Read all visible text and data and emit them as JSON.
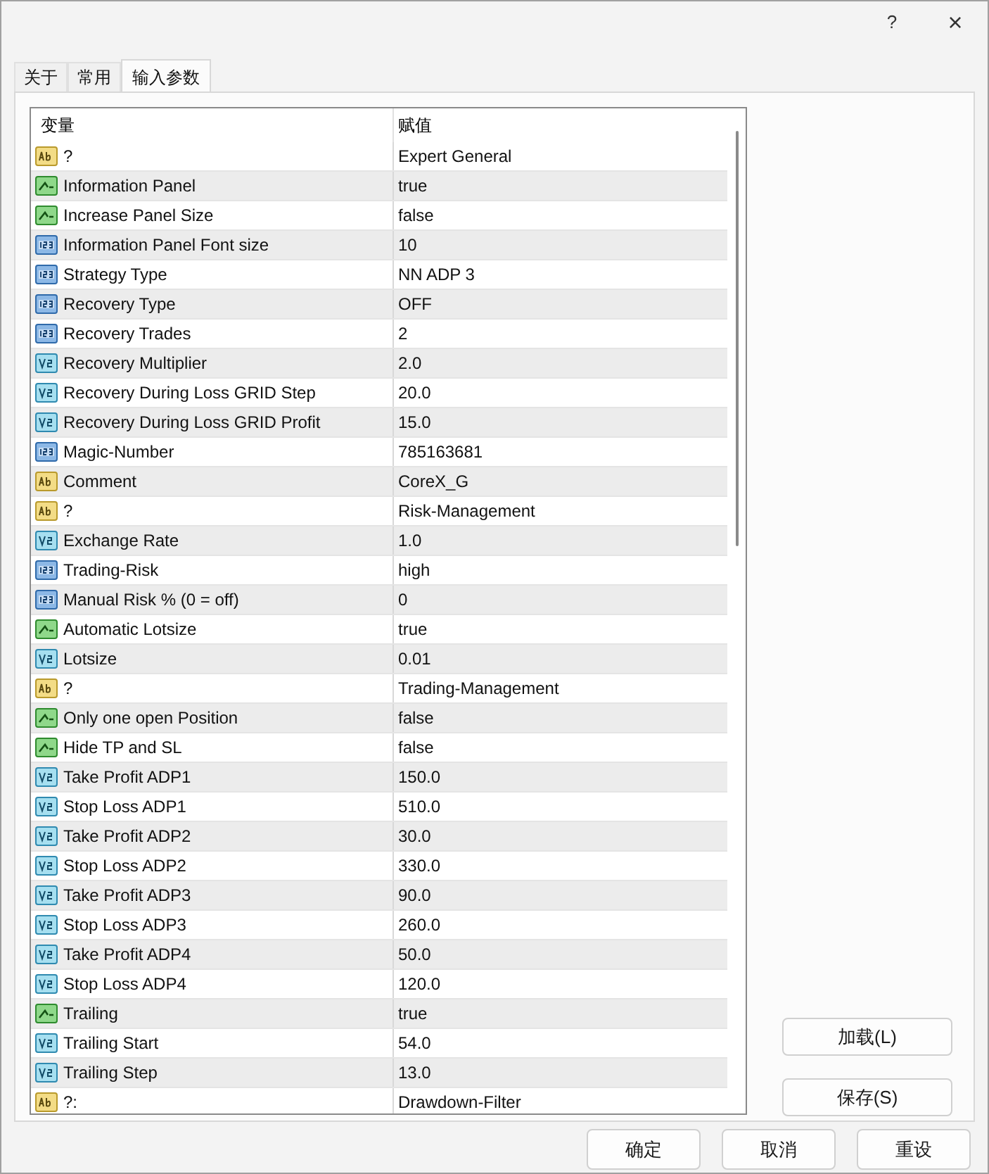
{
  "window": {
    "help": "?",
    "close": "×"
  },
  "tabs": [
    {
      "label": "关于",
      "selected": false
    },
    {
      "label": "常用",
      "selected": false
    },
    {
      "label": "输入参数",
      "selected": true
    }
  ],
  "table": {
    "columns": [
      "变量",
      "赋值"
    ],
    "rows": [
      {
        "kind": "string",
        "name": "?",
        "value": "Expert General"
      },
      {
        "kind": "bool",
        "name": "Information Panel",
        "value": "true"
      },
      {
        "kind": "bool",
        "name": "Increase Panel Size",
        "value": "false"
      },
      {
        "kind": "int",
        "name": "Information Panel Font size",
        "value": "10"
      },
      {
        "kind": "int",
        "name": "Strategy Type",
        "value": "NN ADP 3"
      },
      {
        "kind": "int",
        "name": "Recovery Type",
        "value": "OFF"
      },
      {
        "kind": "int",
        "name": "Recovery Trades",
        "value": "2"
      },
      {
        "kind": "double",
        "name": "Recovery Multiplier",
        "value": "2.0"
      },
      {
        "kind": "double",
        "name": "Recovery During Loss GRID Step",
        "value": "20.0"
      },
      {
        "kind": "double",
        "name": "Recovery During Loss GRID Profit",
        "value": "15.0"
      },
      {
        "kind": "int",
        "name": "Magic-Number",
        "value": "785163681"
      },
      {
        "kind": "string",
        "name": "Comment",
        "value": "CoreX_G"
      },
      {
        "kind": "string",
        "name": "?",
        "value": "Risk-Management"
      },
      {
        "kind": "double",
        "name": "Exchange Rate",
        "value": "1.0"
      },
      {
        "kind": "int",
        "name": "Trading-Risk",
        "value": "high"
      },
      {
        "kind": "int",
        "name": "Manual Risk % (0 = off)",
        "value": "0"
      },
      {
        "kind": "bool",
        "name": "Automatic Lotsize",
        "value": "true"
      },
      {
        "kind": "double",
        "name": "Lotsize",
        "value": "0.01"
      },
      {
        "kind": "string",
        "name": "?",
        "value": "Trading-Management"
      },
      {
        "kind": "bool",
        "name": "Only one open Position",
        "value": "false"
      },
      {
        "kind": "bool",
        "name": "Hide TP and SL",
        "value": "false"
      },
      {
        "kind": "double",
        "name": "Take Profit ADP1",
        "value": "150.0"
      },
      {
        "kind": "double",
        "name": "Stop Loss ADP1",
        "value": "510.0"
      },
      {
        "kind": "double",
        "name": "Take Profit ADP2",
        "value": "30.0"
      },
      {
        "kind": "double",
        "name": "Stop Loss ADP2",
        "value": "330.0"
      },
      {
        "kind": "double",
        "name": "Take Profit ADP3",
        "value": "90.0"
      },
      {
        "kind": "double",
        "name": "Stop Loss ADP3",
        "value": "260.0"
      },
      {
        "kind": "double",
        "name": "Take Profit ADP4",
        "value": "50.0"
      },
      {
        "kind": "double",
        "name": "Stop Loss ADP4",
        "value": "120.0"
      },
      {
        "kind": "bool",
        "name": "Trailing",
        "value": "true"
      },
      {
        "kind": "double",
        "name": "Trailing Start",
        "value": "54.0"
      },
      {
        "kind": "double",
        "name": "Trailing Step",
        "value": "13.0"
      },
      {
        "kind": "string",
        "name": "?:",
        "value": "Drawdown-Filter"
      }
    ]
  },
  "side_buttons": [
    "加载(L)",
    "保存(S)"
  ],
  "buttons": [
    "确定",
    "取消",
    "重设"
  ]
}
